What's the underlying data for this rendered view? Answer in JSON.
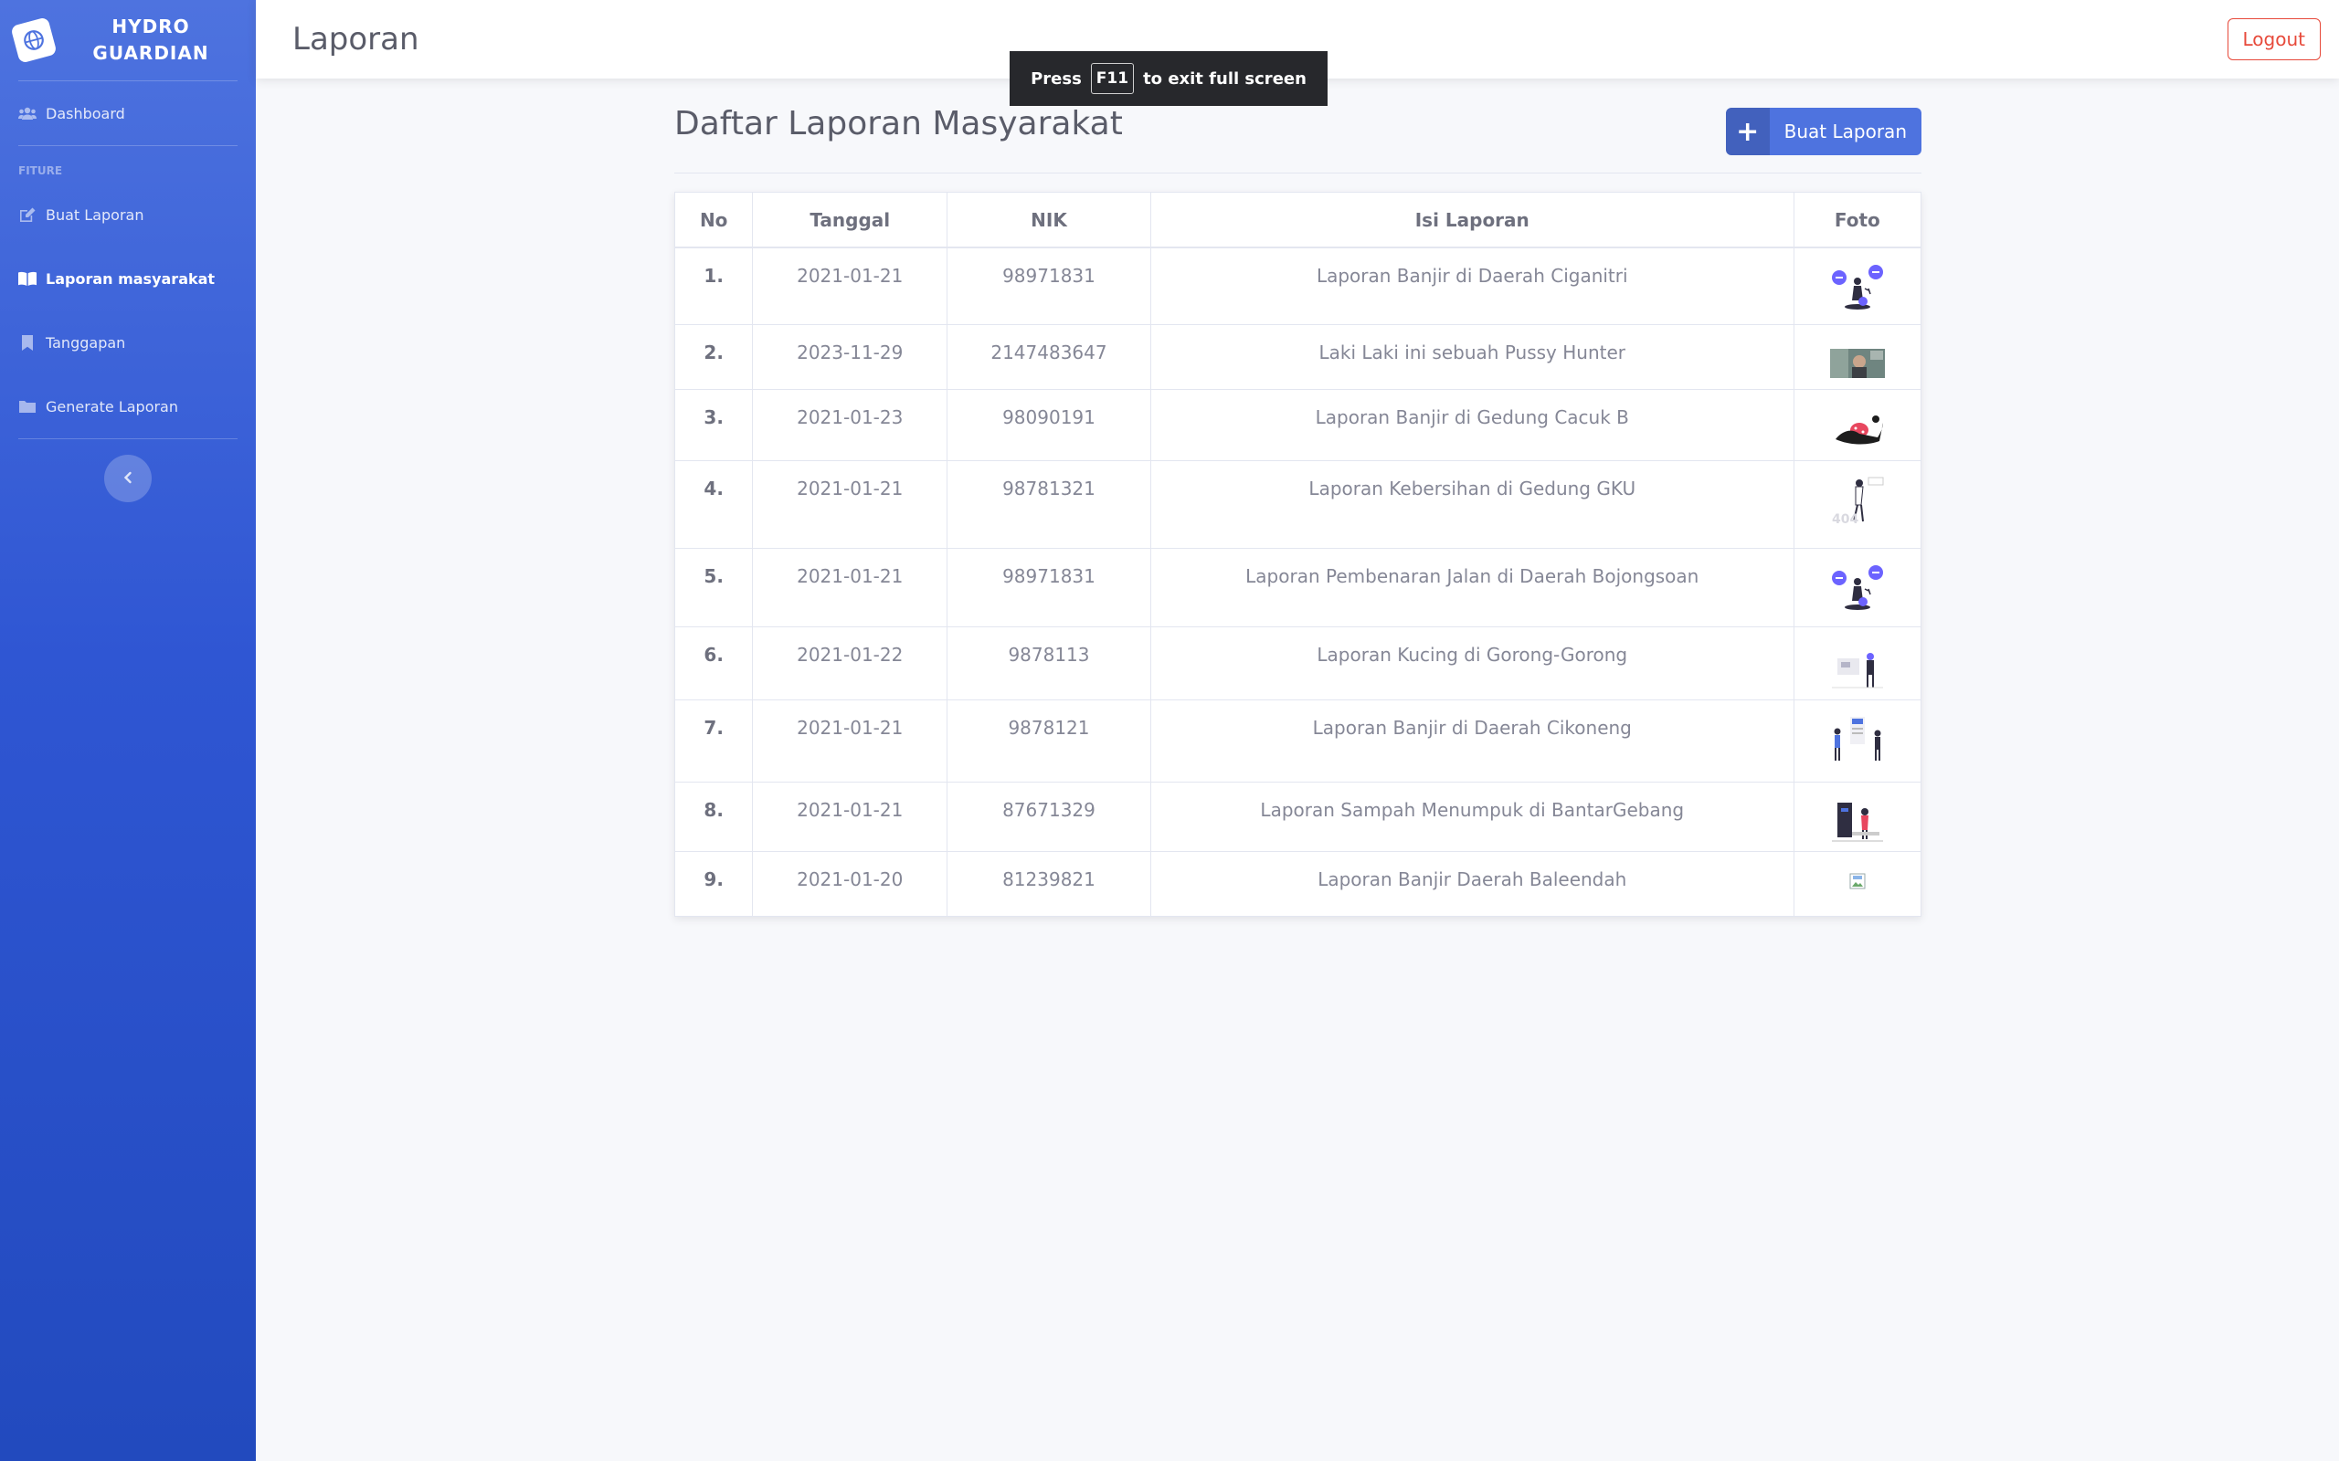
{
  "brand": {
    "line1": "HYDRO",
    "line2": "GUARDIAN",
    "icon": "globe-icon"
  },
  "sidebar": {
    "items_top": [
      {
        "label": "Dashboard",
        "icon": "users-icon"
      }
    ],
    "heading": "FITURE",
    "items": [
      {
        "label": "Buat Laporan",
        "icon": "edit-icon"
      },
      {
        "label": "Laporan masyarakat",
        "icon": "book-open-icon",
        "active": true
      },
      {
        "label": "Tanggapan",
        "icon": "bookmark-icon"
      },
      {
        "label": "Generate Laporan",
        "icon": "folder-icon"
      }
    ],
    "toggle_icon": "chevron-left-icon"
  },
  "topbar": {
    "title": "Laporan",
    "logout": "Logout"
  },
  "fullscreen_toast": {
    "press": "Press",
    "key": "F11",
    "rest": "to exit full screen"
  },
  "main": {
    "heading": "Daftar Laporan Masyarakat",
    "create_button": "Buat Laporan",
    "table": {
      "headers": [
        "No",
        "Tanggal",
        "NIK",
        "Isi Laporan",
        "Foto"
      ],
      "rows": [
        {
          "no": "1.",
          "tanggal": "2021-01-21",
          "nik": "98971831",
          "isi": "Laporan Banjir di Daerah Ciganitri",
          "foto": "illustration-chat"
        },
        {
          "no": "2.",
          "tanggal": "2023-11-29",
          "nik": "2147483647",
          "isi": "Laki Laki ini sebuah Pussy Hunter",
          "foto": "photo"
        },
        {
          "no": "3.",
          "tanggal": "2021-01-23",
          "nik": "98090191",
          "isi": "Laporan Banjir di Gedung Cacuk B",
          "foto": "illustration-fallen"
        },
        {
          "no": "4.",
          "tanggal": "2021-01-21",
          "nik": "98781321",
          "isi": "Laporan Kebersihan di Gedung GKU",
          "foto": "illustration-404"
        },
        {
          "no": "5.",
          "tanggal": "2021-01-21",
          "nik": "98971831",
          "isi": "Laporan Pembenaran Jalan di Daerah Bojongsoan",
          "foto": "illustration-chat"
        },
        {
          "no": "6.",
          "tanggal": "2021-01-22",
          "nik": "9878113",
          "isi": "Laporan Kucing di Gorong-Gorong",
          "foto": "illustration-presentation"
        },
        {
          "no": "7.",
          "tanggal": "2021-01-21",
          "nik": "9878121",
          "isi": "Laporan Banjir di Daerah Cikoneng",
          "foto": "illustration-board"
        },
        {
          "no": "8.",
          "tanggal": "2021-01-21",
          "nik": "87671329",
          "isi": "Laporan Sampah Menumpuk di BantarGebang",
          "foto": "illustration-desk"
        },
        {
          "no": "9.",
          "tanggal": "2021-01-20",
          "nik": "81239821",
          "isi": "Laporan Banjir Daerah Baleendah",
          "foto": "broken-image"
        }
      ]
    }
  },
  "colors": {
    "primary": "#4e73df",
    "danger": "#e74a3b",
    "sidebar_dark": "#224abe",
    "illustration": "#6c63ff"
  }
}
